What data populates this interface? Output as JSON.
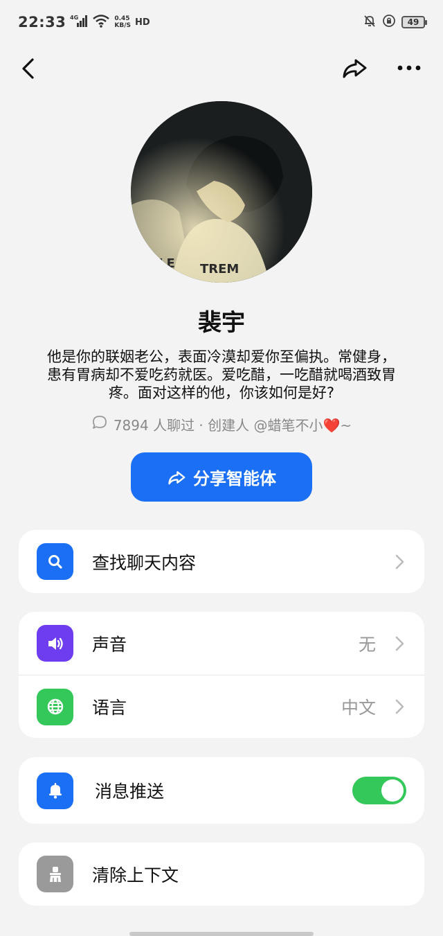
{
  "status_bar": {
    "time": "22:33",
    "network": "4G",
    "speed_value": "0.45",
    "speed_unit": "KB/S",
    "hd": "HD",
    "battery": "49"
  },
  "profile": {
    "name": "裴宇",
    "description": "他是你的联姻老公，表面冷漠却爱你至偏执。常健身，患有胃病却不爱吃药就医。爱吃醋，一吃醋就喝酒致胃疼。面对这样的他，你该如何是好?",
    "meta": "7894 人聊过 · 创建人 @蜡笔不小❤️~",
    "share_button_label": "分享智能体"
  },
  "settings": {
    "search_label": "查找聊天内容",
    "sound_label": "声音",
    "sound_value": "无",
    "language_label": "语言",
    "language_value": "中文",
    "push_label": "消息推送",
    "push_enabled": true,
    "clear_label": "清除上下文"
  },
  "colors": {
    "accent_blue": "#1a6ff5",
    "sound_icon_bg": "#6e3df0",
    "language_icon_bg": "#34c759",
    "clear_icon_bg": "#9a9a9a",
    "toggle_on": "#34c759"
  },
  "icons": {
    "back": "chevron-left-icon",
    "share": "share-arrow-icon",
    "more": "more-dots-icon",
    "search": "search-icon",
    "sound": "speaker-icon",
    "language": "globe-icon",
    "push": "bell-icon",
    "clear": "broom-icon"
  }
}
